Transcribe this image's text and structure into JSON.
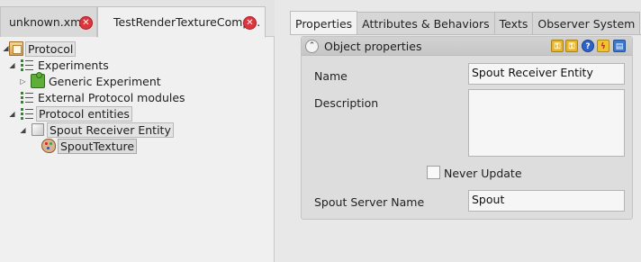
{
  "doc_tabs": [
    {
      "label": "unknown.xml",
      "close": "✕"
    },
    {
      "label": "TestRenderTextureComp...",
      "close": "✕"
    }
  ],
  "tree": {
    "items": [
      {
        "label": "Protocol",
        "icon": "protocol-icon",
        "expander": "◢"
      },
      {
        "label": "Experiments",
        "icon": "list-icon",
        "expander": "◢"
      },
      {
        "label": "Generic Experiment",
        "icon": "puzzle-icon",
        "expander": "▷"
      },
      {
        "label": "External Protocol modules",
        "icon": "list-icon",
        "expander": ""
      },
      {
        "label": "Protocol entities",
        "icon": "list-icon",
        "expander": "◢"
      },
      {
        "label": "Spout Receiver Entity",
        "icon": "cube-icon",
        "expander": "◢"
      },
      {
        "label": "SpoutTexture",
        "icon": "palette-icon",
        "expander": ""
      }
    ]
  },
  "prop_tabs": [
    "Properties",
    "Attributes & Behaviors",
    "Texts",
    "Observer System"
  ],
  "object_panel": {
    "title": "Object properties",
    "collapse_glyph": "⌃",
    "header_icons": [
      "key-icon",
      "keys-icon",
      "help-icon",
      "lightning-icon",
      "save-icon"
    ],
    "header_glyphs": [
      "⚿",
      "⚿",
      "?",
      "ϟ",
      "▤"
    ]
  },
  "fields": {
    "name_label": "Name",
    "name_value": "Spout Receiver Entity",
    "description_label": "Description",
    "description_value": "",
    "never_update_label": "Never Update",
    "never_update_checked": false,
    "spout_server_label": "Spout Server Name",
    "spout_server_value": "Spout"
  }
}
